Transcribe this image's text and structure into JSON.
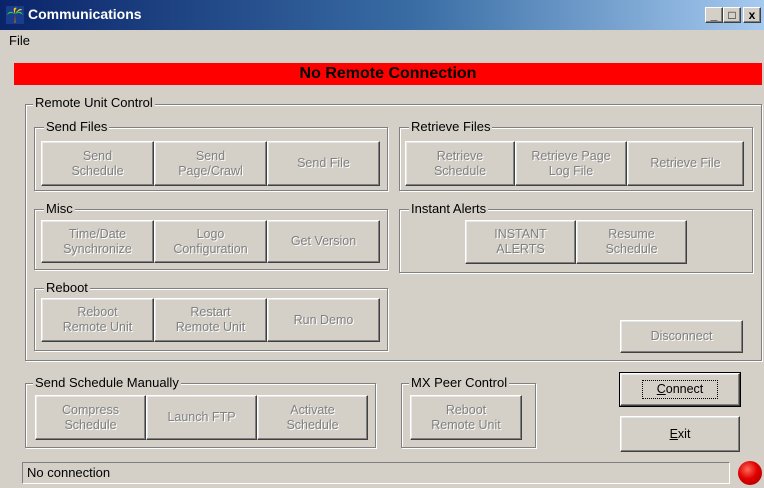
{
  "window": {
    "title": "Communications",
    "icon": "palm-tree-icon",
    "controls": {
      "minimize": "_",
      "maximize": "□",
      "close": "x"
    }
  },
  "menu": {
    "file": "File"
  },
  "banner": {
    "text": "No Remote Connection",
    "color": "#ff0000"
  },
  "remote_unit_control": {
    "label": "Remote Unit Control",
    "send_files": {
      "label": "Send Files",
      "send_schedule": [
        "Send",
        "Schedule"
      ],
      "send_page_crawl": [
        "Send",
        "Page/Crawl"
      ],
      "send_file": "Send File"
    },
    "retrieve_files": {
      "label": "Retrieve Files",
      "retrieve_schedule": [
        "Retrieve",
        "Schedule"
      ],
      "retrieve_page_log": [
        "Retrieve Page",
        "Log File"
      ],
      "retrieve_file": "Retrieve File"
    },
    "misc": {
      "label": "Misc",
      "time_date": [
        "Time/Date",
        "Synchronize"
      ],
      "logo_config": [
        "Logo",
        "Configuration"
      ],
      "get_version": "Get Version"
    },
    "instant_alerts": {
      "label": "Instant Alerts",
      "instant": [
        "INSTANT",
        "ALERTS"
      ],
      "resume": [
        "Resume",
        "Schedule"
      ]
    },
    "reboot": {
      "label": "Reboot",
      "reboot_remote": [
        "Reboot",
        "Remote Unit"
      ],
      "restart_remote": [
        "Restart",
        "Remote Unit"
      ],
      "run_demo": "Run Demo"
    },
    "disconnect": "Disconnect"
  },
  "send_schedule_manually": {
    "label": "Send Schedule Manually",
    "compress": [
      "Compress",
      "Schedule"
    ],
    "launch_ftp": "Launch FTP",
    "activate": [
      "Activate",
      "Schedule"
    ]
  },
  "mx_peer_control": {
    "label": "MX Peer Control",
    "reboot_remote": [
      "Reboot",
      "Remote Unit"
    ]
  },
  "connect": {
    "hotkey": "C",
    "rest": "onnect"
  },
  "exit": {
    "hotkey": "E",
    "rest": "xit"
  },
  "status": {
    "text": "No connection",
    "indicator_color": "#e00000"
  }
}
